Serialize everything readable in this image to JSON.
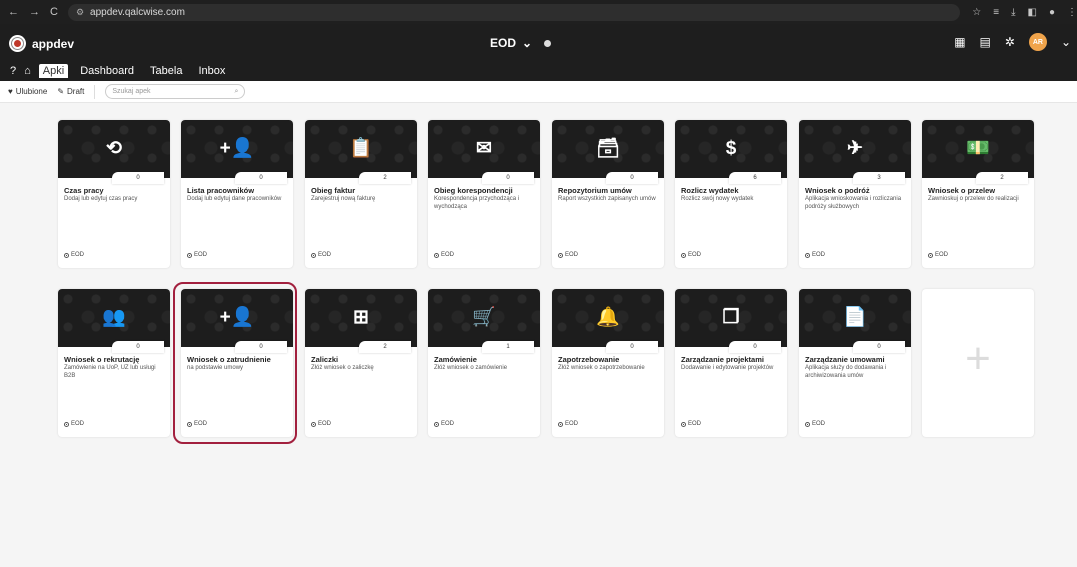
{
  "browser": {
    "url": "appdev.qalcwise.com"
  },
  "app": {
    "name": "appdev",
    "workspace": "EOD",
    "user_initials": "AR",
    "tabs": [
      {
        "label": "Apki",
        "active": true
      },
      {
        "label": "Dashboard",
        "active": false
      },
      {
        "label": "Tabela",
        "active": false
      },
      {
        "label": "Inbox",
        "active": false
      }
    ]
  },
  "toolbar": {
    "favorites_label": "Ulubione",
    "draft_label": "Draft",
    "search_placeholder": "Szukaj apek"
  },
  "cards": [
    {
      "title": "Czas pracy",
      "desc": "Dodaj lub edytuj czas pracy",
      "count": "0",
      "tag": "EOD",
      "icon": "history-icon",
      "glyph": "⟲"
    },
    {
      "title": "Lista pracowników",
      "desc": "Dodaj lub edytuj dane pracowników",
      "count": "0",
      "tag": "EOD",
      "icon": "add-person-icon",
      "glyph": "+👤"
    },
    {
      "title": "Obieg faktur",
      "desc": "Zarejestruj nową fakturę",
      "count": "2",
      "tag": "EOD",
      "icon": "clipboard-icon",
      "glyph": "📋"
    },
    {
      "title": "Obieg korespondencji",
      "desc": "Korespondencja przychodząca i wychodząca",
      "count": "0",
      "tag": "EOD",
      "icon": "envelope-icon",
      "glyph": "✉"
    },
    {
      "title": "Repozytorium umów",
      "desc": "Raport wszystkich zapisanych umów",
      "count": "0",
      "tag": "EOD",
      "icon": "archive-icon",
      "glyph": "🗃"
    },
    {
      "title": "Rozlicz wydatek",
      "desc": "Rozlicz swój nowy wydatek",
      "count": "6",
      "tag": "EOD",
      "icon": "dollar-icon",
      "glyph": "$"
    },
    {
      "title": "Wniosek o podróż",
      "desc": "Aplikacja wnioskowania i rozliczania podróży służbowych",
      "count": "3",
      "tag": "EOD",
      "icon": "airplane-icon",
      "glyph": "✈"
    },
    {
      "title": "Wniosek o przelew",
      "desc": "Zawnioskuj o przelew do realizacji",
      "count": "2",
      "tag": "EOD",
      "icon": "money-icon",
      "glyph": "💵"
    },
    {
      "title": "Wniosek o rekrutację",
      "desc": "Zamówienie na UoP, UZ lub usługi B2B",
      "count": "0",
      "tag": "EOD",
      "icon": "people-icon",
      "glyph": "👥"
    },
    {
      "title": "Wniosek o zatrudnienie",
      "desc": "na podstawie umowy",
      "count": "0",
      "tag": "EOD",
      "icon": "add-person-icon",
      "glyph": "+👤"
    },
    {
      "title": "Zaliczki",
      "desc": "Złóż wniosek o zaliczkę",
      "count": "2",
      "tag": "EOD",
      "icon": "library-add-icon",
      "glyph": "⊞"
    },
    {
      "title": "Zamówienie",
      "desc": "Złóż wniosek o zamówienie",
      "count": "1",
      "tag": "EOD",
      "icon": "cart-add-icon",
      "glyph": "🛒"
    },
    {
      "title": "Zapotrzebowanie",
      "desc": "Złóż wniosek o zapotrzebowanie",
      "count": "0",
      "tag": "EOD",
      "icon": "bell-add-icon",
      "glyph": "🔔"
    },
    {
      "title": "Zarządzanie projektami",
      "desc": "Dodawanie i edytowanie projektów",
      "count": "0",
      "tag": "EOD",
      "icon": "collections-icon",
      "glyph": "❐"
    },
    {
      "title": "Zarządzanie umowami",
      "desc": "Aplikacja służy do dodawania i archiwizowania umów",
      "count": "0",
      "tag": "EOD",
      "icon": "document-icon",
      "glyph": "📄"
    }
  ],
  "add_card": {
    "glyph": "+"
  }
}
